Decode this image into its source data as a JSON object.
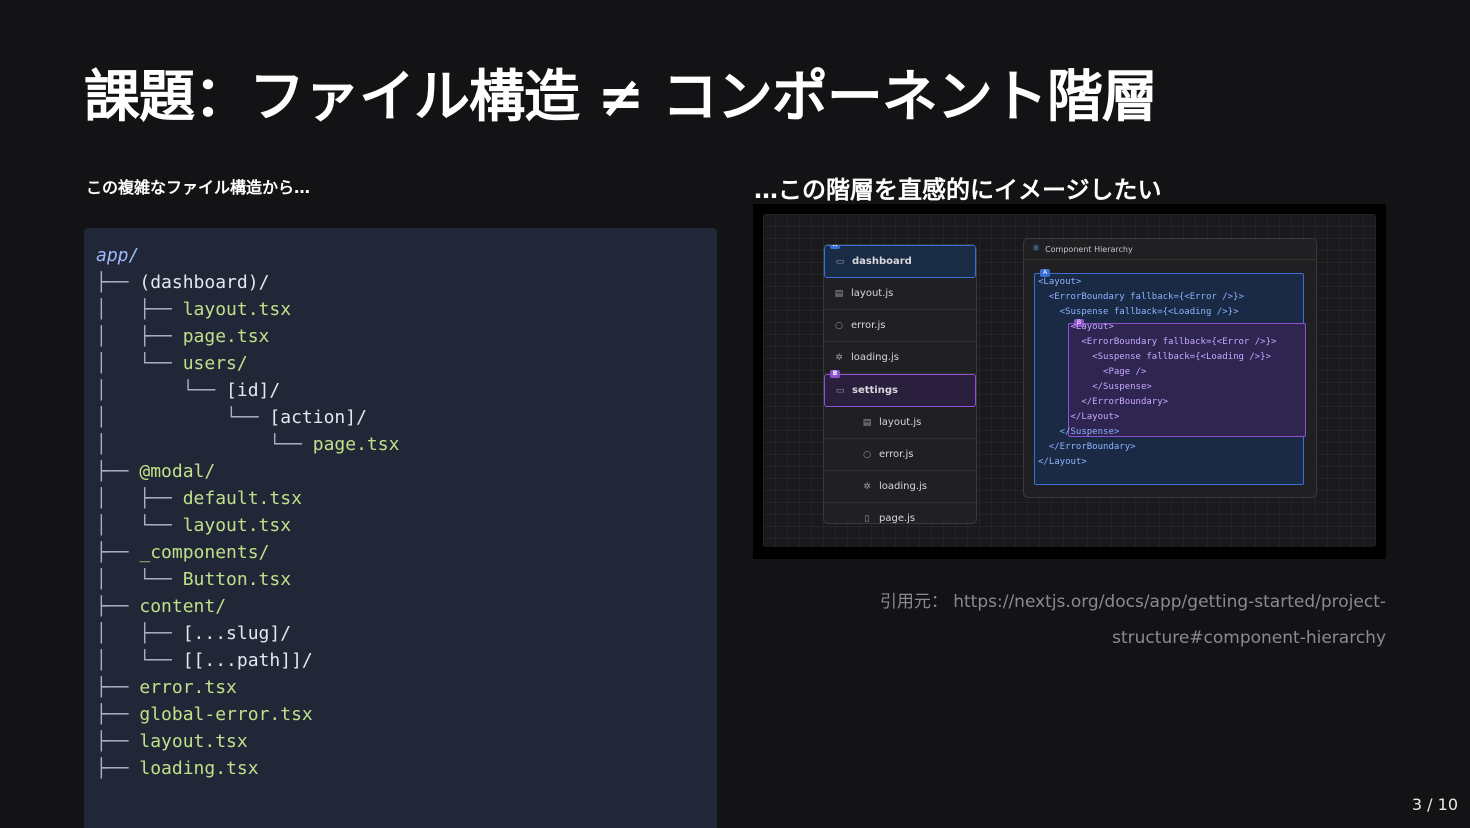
{
  "title": "課題：ファイル構造 ≠ コンポーネント階層",
  "left_caption": "この複雑なファイル構造から…",
  "right_caption": "…この階層を直感的にイメージしたい",
  "code_tree": [
    {
      "prefix": "",
      "name": "app/",
      "kind": "dir"
    },
    {
      "prefix": "├── ",
      "name": "(dashboard)/",
      "kind": "group"
    },
    {
      "prefix": "│   ├── ",
      "name": "layout.tsx",
      "kind": "file"
    },
    {
      "prefix": "│   ├── ",
      "name": "page.tsx",
      "kind": "file"
    },
    {
      "prefix": "│   └── ",
      "name": "users/",
      "kind": "file"
    },
    {
      "prefix": "│       └── ",
      "name": "[id]/",
      "kind": "plain"
    },
    {
      "prefix": "│           └── ",
      "name": "[action]/",
      "kind": "plain"
    },
    {
      "prefix": "│               └── ",
      "name": "page.tsx",
      "kind": "file"
    },
    {
      "prefix": "├── ",
      "name": "@modal/",
      "kind": "file"
    },
    {
      "prefix": "│   ├── ",
      "name": "default.tsx",
      "kind": "file"
    },
    {
      "prefix": "│   └── ",
      "name": "layout.tsx",
      "kind": "file"
    },
    {
      "prefix": "├── ",
      "name": "_components/",
      "kind": "file"
    },
    {
      "prefix": "│   └── ",
      "name": "Button.tsx",
      "kind": "file"
    },
    {
      "prefix": "├── ",
      "name": "content/",
      "kind": "file"
    },
    {
      "prefix": "│   ├── ",
      "name": "[...slug]/",
      "kind": "plain"
    },
    {
      "prefix": "│   └── ",
      "name": "[[...path]]/",
      "kind": "plain"
    },
    {
      "prefix": "├── ",
      "name": "error.tsx",
      "kind": "file"
    },
    {
      "prefix": "├── ",
      "name": "global-error.tsx",
      "kind": "file"
    },
    {
      "prefix": "├── ",
      "name": "layout.tsx",
      "kind": "file"
    },
    {
      "prefix": "├── ",
      "name": "loading.tsx",
      "kind": "file"
    }
  ],
  "screenshot": {
    "file_tree": [
      {
        "label": "dashboard",
        "icon": "folder-icon",
        "style": "sel-a",
        "badge": "A",
        "indent": 0
      },
      {
        "label": "layout.js",
        "icon": "layout-icon",
        "style": "",
        "badge": "",
        "indent": 0
      },
      {
        "label": "error.js",
        "icon": "error-icon",
        "style": "",
        "badge": "",
        "indent": 0
      },
      {
        "label": "loading.js",
        "icon": "loading-icon",
        "style": "",
        "badge": "",
        "indent": 0
      },
      {
        "label": "settings",
        "icon": "folder-icon",
        "style": "sel-b",
        "badge": "B",
        "indent": 0
      },
      {
        "label": "layout.js",
        "icon": "layout-icon",
        "style": "",
        "badge": "",
        "indent": 1
      },
      {
        "label": "error.js",
        "icon": "error-icon",
        "style": "",
        "badge": "",
        "indent": 1
      },
      {
        "label": "loading.js",
        "icon": "loading-icon",
        "style": "",
        "badge": "",
        "indent": 1
      },
      {
        "label": "page.js",
        "icon": "page-icon",
        "style": "",
        "badge": "",
        "indent": 1
      }
    ],
    "panel_title": "Component Hierarchy",
    "badge_a": "A",
    "badge_b": "B",
    "hierarchy_lines": [
      {
        "text": "<Layout>",
        "inner": false
      },
      {
        "text": "  <ErrorBoundary fallback={<Error />}>",
        "inner": false
      },
      {
        "text": "    <Suspense fallback={<Loading />}>",
        "inner": false
      },
      {
        "text": "      <Layout>",
        "inner": true
      },
      {
        "text": "        <ErrorBoundary fallback={<Error />}>",
        "inner": true
      },
      {
        "text": "          <Suspense fallback={<Loading />}>",
        "inner": true
      },
      {
        "text": "            <Page />",
        "inner": true
      },
      {
        "text": "          </Suspense>",
        "inner": true
      },
      {
        "text": "        </ErrorBoundary>",
        "inner": true
      },
      {
        "text": "      </Layout>",
        "inner": true
      },
      {
        "text": "    </Suspense>",
        "inner": false
      },
      {
        "text": "  </ErrorBoundary>",
        "inner": false
      },
      {
        "text": "</Layout>",
        "inner": false
      }
    ]
  },
  "citation": {
    "label": "引用元：",
    "url_line1": "https://nextjs.org/docs/app/getting-started/project-",
    "url_line2": "structure#component-hierarchy"
  },
  "page_number": "3 / 10",
  "colors": {
    "background": "#131315",
    "code_bg": "#222738",
    "file_green": "#bfe08a",
    "dir_blue": "#9fb6ff",
    "accent_blue": "#3b6fd6",
    "accent_purple": "#8e52d0"
  }
}
